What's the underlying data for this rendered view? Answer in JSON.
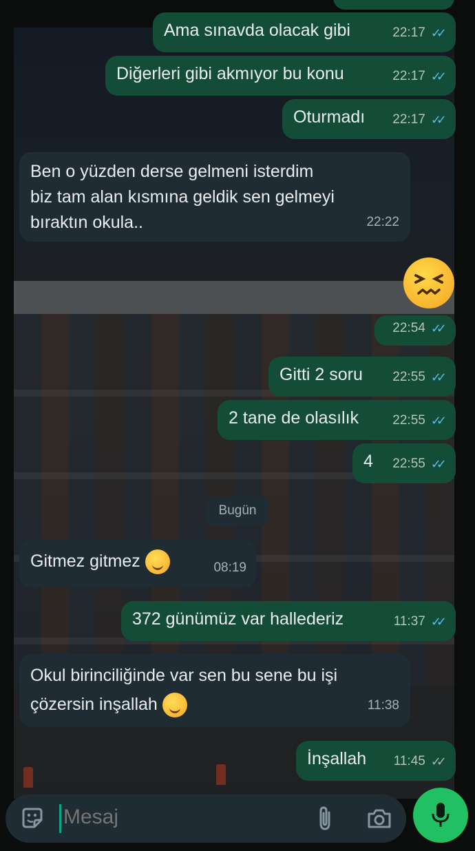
{
  "composer": {
    "placeholder": "Mesaj"
  },
  "date_separator": "Bugün",
  "messages": [
    {
      "text": "Ama sınavda olacak gibi",
      "time": "22:17",
      "dir": "out",
      "status": "read"
    },
    {
      "text": "Diğerleri gibi akmıyor bu konu",
      "time": "22:17",
      "dir": "out",
      "status": "read"
    },
    {
      "text": "Oturmadı",
      "time": "22:17",
      "dir": "out",
      "status": "read"
    },
    {
      "text": "Ben o yüzden derse gelmeni isterdim\nbiz tam alan kısmına geldik sen gelmeyi\nbıraktın okula..",
      "time": "22:22",
      "dir": "in"
    },
    {
      "text": "",
      "time": "22:54",
      "dir": "out",
      "status": "read",
      "emoji": "confounded-face"
    },
    {
      "text": "Gitti 2 soru",
      "time": "22:55",
      "dir": "out",
      "status": "read"
    },
    {
      "text": "2 tane de olasılık",
      "time": "22:55",
      "dir": "out",
      "status": "read"
    },
    {
      "text": "4",
      "time": "22:55",
      "dir": "out",
      "status": "read"
    },
    {
      "text": "Gitmez gitmez",
      "time": "08:19",
      "dir": "in",
      "emoji": "smiling-face"
    },
    {
      "text": "372 günümüz var hallederiz",
      "time": "11:37",
      "dir": "out",
      "status": "read"
    },
    {
      "text": "Okul birinciliğinde var sen bu sene bu işi\nçözersin inşallah",
      "time": "11:38",
      "dir": "in",
      "emoji": "smiling-face"
    },
    {
      "text": "İnşallah",
      "time": "11:45",
      "dir": "out",
      "status": "delivered"
    }
  ],
  "colors": {
    "outgoing_bubble": "#134d37",
    "incoming_bubble": "#1f2c33",
    "read_ticks": "#53bdeb",
    "mic_button": "#21c063"
  },
  "icons": [
    "sticker-icon",
    "attach-icon",
    "camera-icon",
    "mic-icon",
    "double-check-icon"
  ]
}
